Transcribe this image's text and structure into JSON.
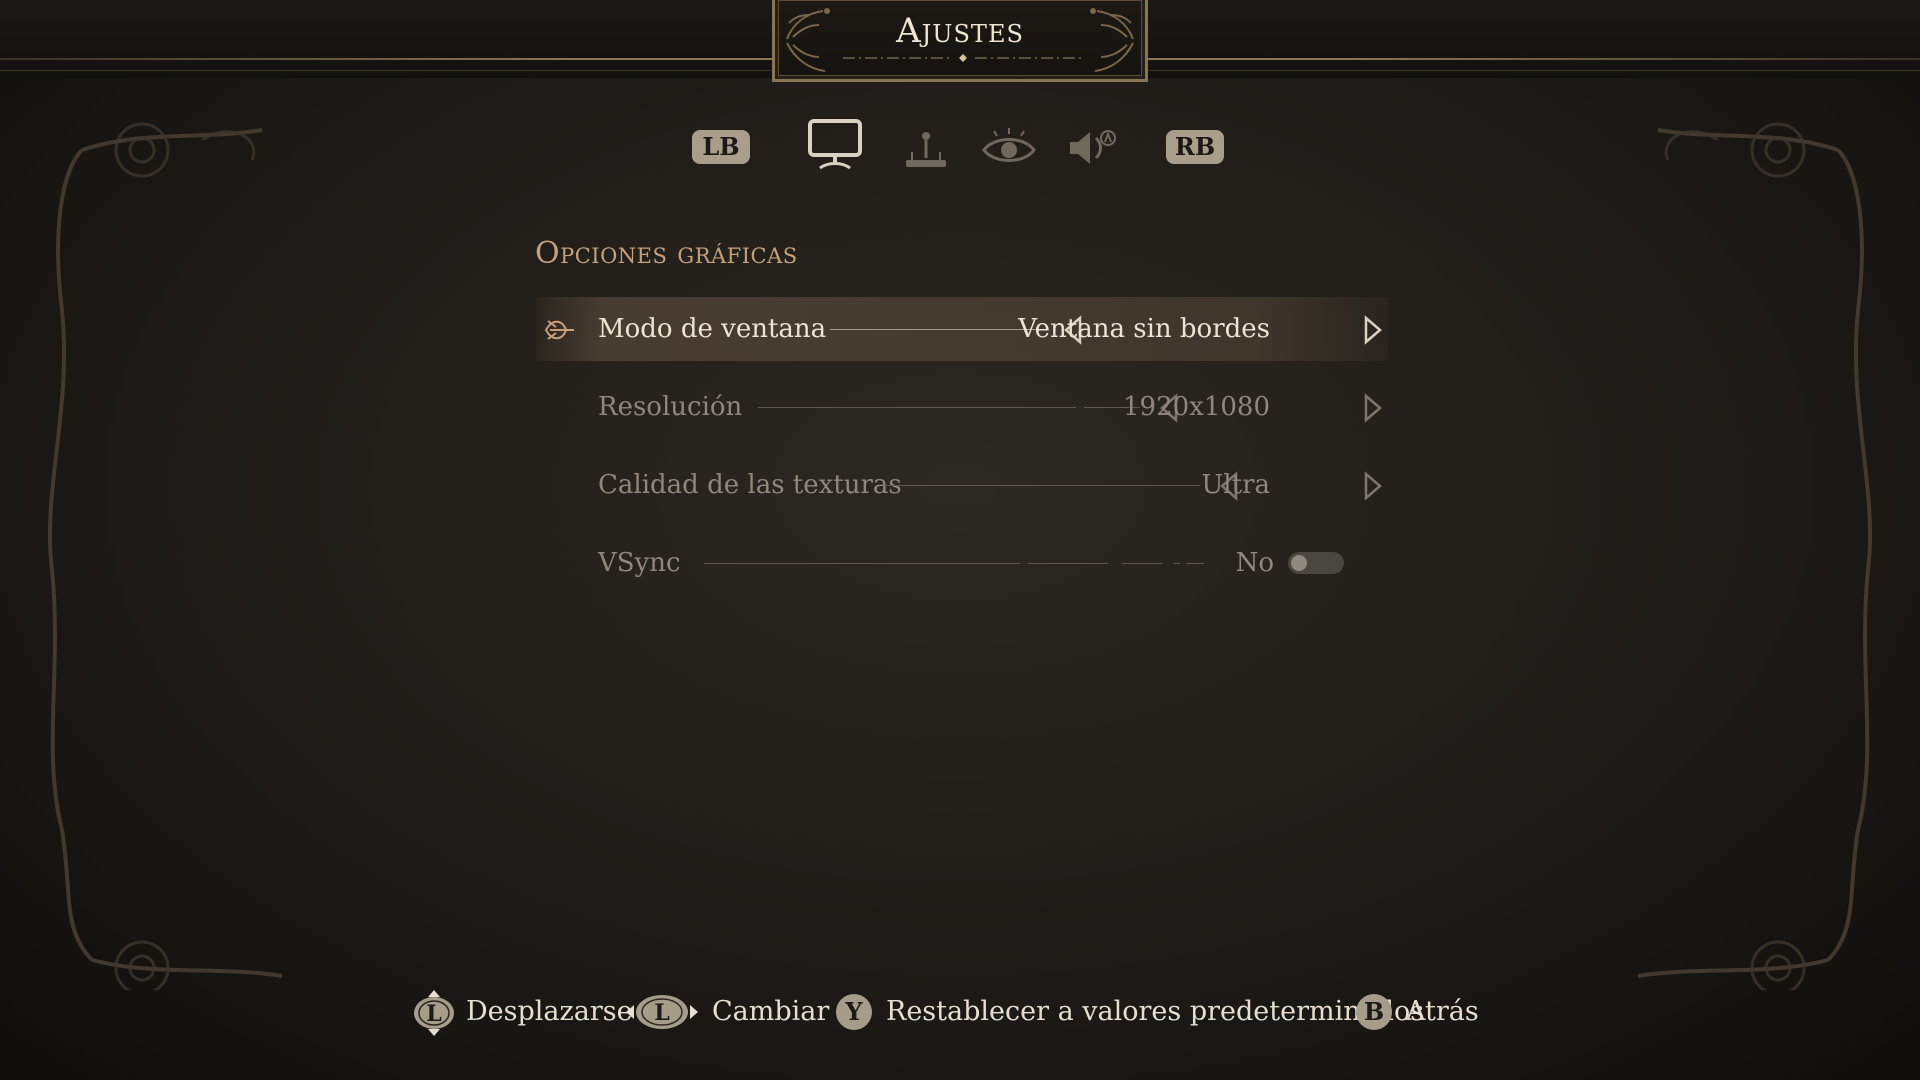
{
  "header": {
    "title": "Ajustes"
  },
  "tabs": {
    "prev_bumper": "LB",
    "next_bumper": "RB",
    "items": [
      {
        "icon": "monitor-icon",
        "active": true
      },
      {
        "icon": "joystick-icon",
        "active": false
      },
      {
        "icon": "eye-icon",
        "active": false
      },
      {
        "icon": "speaker-icon",
        "active": false
      }
    ]
  },
  "section": {
    "title": "Opciones gráficas"
  },
  "settings": [
    {
      "label": "Modo de ventana",
      "value": "Ventana sin bordes",
      "type": "selector",
      "selected": true
    },
    {
      "label": "Resolución",
      "value": "1920x1080",
      "type": "selector",
      "selected": false
    },
    {
      "label": "Calidad de las texturas",
      "value": "Ultra",
      "type": "selector",
      "selected": false
    },
    {
      "label": "VSync",
      "value": "No",
      "type": "toggle",
      "on": false,
      "selected": false
    }
  ],
  "footer": {
    "hints": [
      {
        "button": "L",
        "icon": "left-stick-vertical-icon",
        "label": "Desplazarse"
      },
      {
        "button": "L",
        "icon": "left-stick-horizontal-icon",
        "label": "Cambiar"
      },
      {
        "button": "Y",
        "icon": "y-button-icon",
        "label": "Restablecer a valores predeterminados"
      },
      {
        "button": "B",
        "icon": "b-button-icon",
        "label": "Atrás"
      }
    ]
  },
  "colors": {
    "accent": "#c7a07a",
    "gold_line": "#8c7650",
    "text_active": "#ece4d4",
    "text_inactive": "#8e877c"
  }
}
